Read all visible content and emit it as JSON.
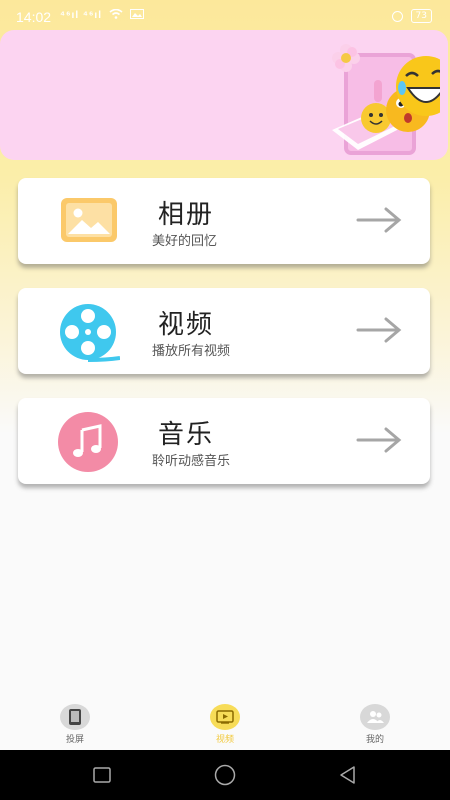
{
  "status_bar": {
    "time": "14:02",
    "signal_text": "⁴⁶ıl ⁴⁶ıl",
    "battery": "73"
  },
  "cards": [
    {
      "title": "相册",
      "subtitle": "美好的回忆",
      "icon": "photo-album-icon"
    },
    {
      "title": "视频",
      "subtitle": "播放所有视频",
      "icon": "film-reel-icon"
    },
    {
      "title": "音乐",
      "subtitle": "聆听动感音乐",
      "icon": "music-note-icon"
    }
  ],
  "bottom_nav": {
    "items": [
      {
        "label": "投屏",
        "icon": "cast-screen-icon",
        "active": false
      },
      {
        "label": "视频",
        "icon": "video-play-icon",
        "active": true
      },
      {
        "label": "我的",
        "icon": "profile-icon",
        "active": false
      }
    ]
  },
  "colors": {
    "accent": "#f2c93c",
    "banner": "#fcd4f1",
    "music_icon": "#f38ba6",
    "video_icon": "#3fc8ee",
    "album_icon": "#fbc96a"
  }
}
